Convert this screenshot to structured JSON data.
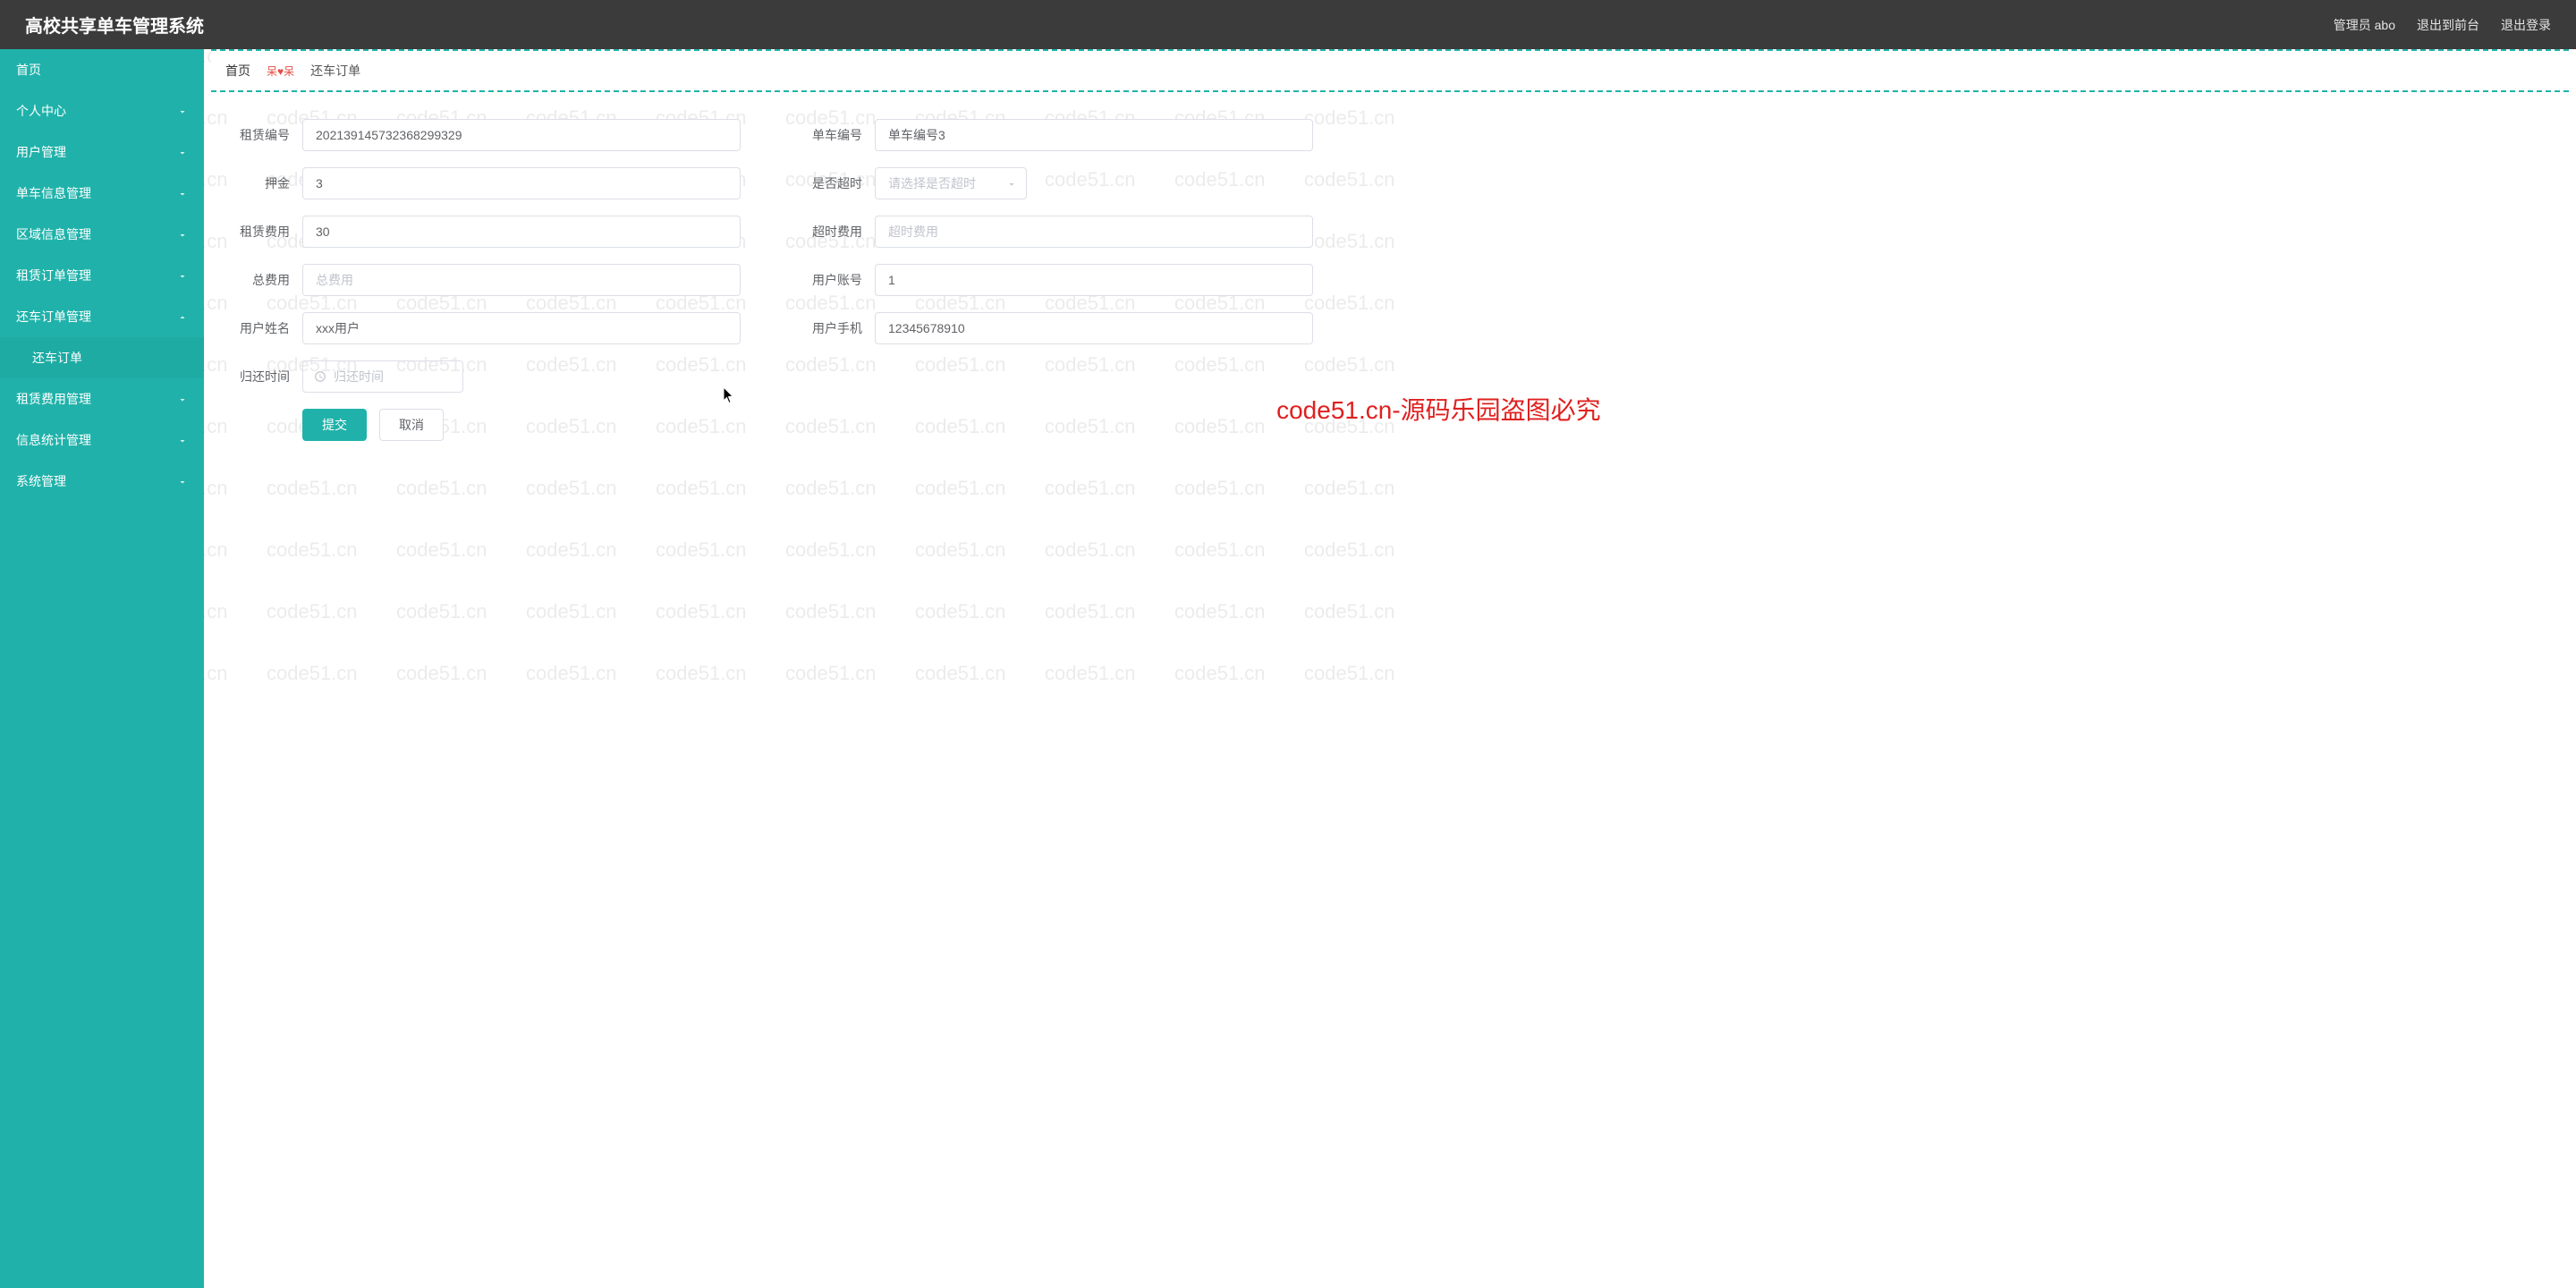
{
  "header": {
    "title": "高校共享单车管理系统",
    "adminLabel": "管理员 abo",
    "exitFrontend": "退出到前台",
    "logout": "退出登录"
  },
  "sidebar": {
    "items": [
      {
        "label": "首页",
        "expand": false
      },
      {
        "label": "个人中心",
        "expand": true,
        "dir": "down"
      },
      {
        "label": "用户管理",
        "expand": true,
        "dir": "down"
      },
      {
        "label": "单车信息管理",
        "expand": true,
        "dir": "down"
      },
      {
        "label": "区域信息管理",
        "expand": true,
        "dir": "down"
      },
      {
        "label": "租赁订单管理",
        "expand": true,
        "dir": "down"
      },
      {
        "label": "还车订单管理",
        "expand": true,
        "dir": "up"
      },
      {
        "label": "还车订单",
        "expand": false,
        "sub": true
      },
      {
        "label": "租赁费用管理",
        "expand": true,
        "dir": "down"
      },
      {
        "label": "信息统计管理",
        "expand": true,
        "dir": "down"
      },
      {
        "label": "系统管理",
        "expand": true,
        "dir": "down"
      }
    ]
  },
  "tabs": {
    "home": "首页",
    "love": "呆♥呆",
    "active": "还车订单"
  },
  "form": {
    "rentNo": {
      "label": "租赁编号",
      "value": "202139145732368299329"
    },
    "bikeNo": {
      "label": "单车编号",
      "value": "单车编号3"
    },
    "deposit": {
      "label": "押金",
      "value": "3"
    },
    "timeout": {
      "label": "是否超时",
      "placeholder": "请选择是否超时"
    },
    "rentFee": {
      "label": "租赁费用",
      "value": "30"
    },
    "timeoutFee": {
      "label": "超时费用",
      "placeholder": "超时费用"
    },
    "totalFee": {
      "label": "总费用",
      "placeholder": "总费用"
    },
    "userAcct": {
      "label": "用户账号",
      "value": "1"
    },
    "userName": {
      "label": "用户姓名",
      "value": "xxx用户"
    },
    "userPhone": {
      "label": "用户手机",
      "value": "12345678910"
    },
    "returnTime": {
      "label": "归还时间",
      "placeholder": "归还时间"
    },
    "submit": "提交",
    "cancel": "取消"
  },
  "watermark": {
    "text": "code51.cn",
    "big": "code51.cn-源码乐园盗图必究"
  }
}
